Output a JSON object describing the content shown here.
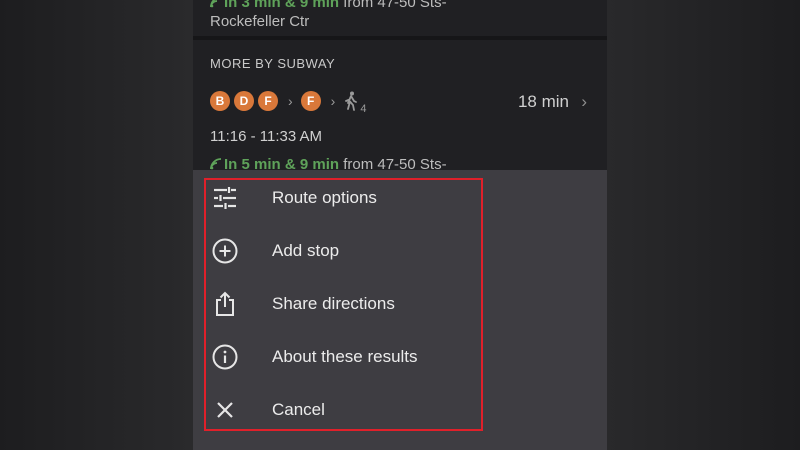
{
  "top_card": {
    "realtime_prefix": "In 3 min & 9 min",
    "realtime_rest": " from 47-50 Sts-",
    "station_line2": "Rockefeller Ctr"
  },
  "subway_section": {
    "title": "MORE BY SUBWAY",
    "first_leg_badges": [
      "B",
      "D",
      "F"
    ],
    "second_leg_badges": [
      "F"
    ],
    "walk_minutes": "4",
    "duration": "18 min",
    "time_range": "11:16 - 11:33 AM",
    "realtime_prefix": "In 5 min & 9 min",
    "realtime_rest": " from 47-50 Sts-",
    "badge_color": "#d9783a",
    "realtime_color": "#5fa35a"
  },
  "action_sheet": {
    "items": [
      {
        "label": "Route options",
        "icon": "tune-icon"
      },
      {
        "label": "Add stop",
        "icon": "add-circle-icon"
      },
      {
        "label": "Share directions",
        "icon": "share-icon"
      },
      {
        "label": "About these results",
        "icon": "info-icon"
      },
      {
        "label": "Cancel",
        "icon": "close-icon"
      }
    ],
    "highlight_color": "#e0202a"
  }
}
